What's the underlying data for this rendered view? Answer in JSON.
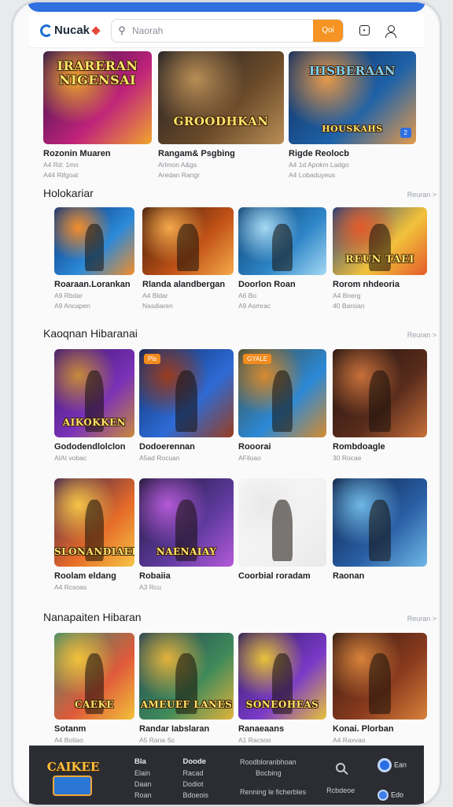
{
  "app": {
    "logo_text": "Nucak"
  },
  "search": {
    "placeholder": "Naorah",
    "button_label": "Qoi"
  },
  "header_icons": {
    "box_icon": "square-icon",
    "user_icon": "user-icon"
  },
  "featured": [
    {
      "art_title": "IRARERAN NIGENSAI",
      "title": "Rozonin Muaren",
      "sub1": "A4 Rd: 1mo",
      "sub2": "A44 Rifgoat",
      "colors": [
        "#2a1249",
        "#c0237a",
        "#f0a52d"
      ]
    },
    {
      "art_title": "GROODHKAN",
      "title": "Rangam& Psgbing",
      "sub1": "Arlmon A&gs",
      "sub2": "Aredan Rangr",
      "colors": [
        "#1c1c22",
        "#6a4a2a",
        "#b98d55"
      ]
    },
    {
      "art_title": "HISBERAAN",
      "art_sub": "HOUSKAHS",
      "badge": "2",
      "title": "Rigde Reolocb",
      "sub1": "A4 1d Apokm Ladgo",
      "sub2": "A4 Lobaduyeus",
      "colors": [
        "#0f2b5a",
        "#1f62a8",
        "#e69a4b"
      ]
    }
  ],
  "section1": {
    "title": "Holokariar",
    "see_more": "Reuran >",
    "items": [
      {
        "title": "Roaraan.Lorankan",
        "sub1": "A9 Rbdar",
        "sub2": "A9 Ancapen",
        "colors": [
          "#0b2f74",
          "#2c8ad8",
          "#f38d2a"
        ]
      },
      {
        "title": "Rlanda alandbergan",
        "sub1": "A4 Bldar",
        "sub2": "Nasdiaren",
        "colors": [
          "#3a160a",
          "#c25318",
          "#f4a94a"
        ]
      },
      {
        "title": "Doorlon Roan",
        "sub1": "A6 Bo",
        "sub2": "A9 Asmrac",
        "colors": [
          "#0a3e6e",
          "#2f86c8",
          "#a5d9f4"
        ]
      },
      {
        "art_title": "REUN TAEI",
        "title": "Rorom nhdeoria",
        "sub1": "A4 Bnerg",
        "sub2": "40 Barsian",
        "colors": [
          "#1a3c80",
          "#f2c23b",
          "#e45b2a"
        ]
      }
    ]
  },
  "section2": {
    "title": "Kaoqnan Hibaranai",
    "see_more": "Reuran >",
    "row1": [
      {
        "art_title": "AIKOKKEN",
        "title": "Gododendlolclon",
        "sub1": "AIAI vobac",
        "colors": [
          "#3b1670",
          "#7b32b8",
          "#c88a3a"
        ]
      },
      {
        "title": "Dodoerennan",
        "sub1": "A5ad Rocuan",
        "badge": "Pls",
        "colors": [
          "#0c2a62",
          "#2e6bd6",
          "#9a3c1e"
        ]
      },
      {
        "badge": "GYALE",
        "title": "Rooorai",
        "sub1": "AFiloao",
        "colors": [
          "#3e4a3a",
          "#2c89d6",
          "#d68a2e"
        ]
      },
      {
        "title": "Rombdoagle",
        "sub1": "30 Rocae",
        "colors": [
          "#1d1311",
          "#5a2c1c",
          "#c8703a"
        ]
      }
    ],
    "row2": [
      {
        "art_title": "SLONANDIAEK",
        "title": "Roolam eldang",
        "sub1": "A4 Rcsoas",
        "colors": [
          "#3a1e52",
          "#e66b28",
          "#f6c546"
        ]
      },
      {
        "art_title": "NAENAIAY",
        "title": "Robaiia",
        "sub1": "A3 Rcu",
        "colors": [
          "#1a1630",
          "#5e3a9e",
          "#b45ad8"
        ]
      },
      {
        "title": "Coorbial roradam",
        "sub1": "",
        "colors": [
          "#f7f7f7",
          "#f2f2f2",
          "#e9e9e9"
        ]
      },
      {
        "title": "Raonan",
        "sub1": "",
        "colors": [
          "#0b1e40",
          "#2a5fa6",
          "#6fb8e6"
        ]
      }
    ]
  },
  "section3": {
    "title": "Nanapaiten Hibaran",
    "see_more": "Reuran >",
    "items": [
      {
        "art_title": "CAEKE",
        "title": "Sotanm",
        "sub1": "A4 Botiao",
        "colors": [
          "#3a8a6a",
          "#e05a3a",
          "#f2c23a"
        ]
      },
      {
        "art_title": "AMEUEF LANES",
        "title": "Randar Iabslaran",
        "sub1": "A5 Rana Sc",
        "colors": [
          "#1d3e56",
          "#3f8a5a",
          "#e3b33c"
        ]
      },
      {
        "art_title": "SONEOHEAS",
        "title": "Ranaeaans",
        "sub1": "A1 Racsoo",
        "colors": [
          "#2a1a5a",
          "#7a3ac8",
          "#e8c23a"
        ]
      },
      {
        "title": "Konai. Plorban",
        "sub1": "A4 Raxvao",
        "colors": [
          "#2c1a14",
          "#8a3a1e",
          "#d8823a"
        ]
      }
    ]
  },
  "bottom_nav": {
    "logo_text": "CAIKEE",
    "col1": {
      "head": "Bla",
      "items": [
        "Elain",
        "Daan",
        "Roan"
      ]
    },
    "col2": {
      "head": "Doode",
      "items": [
        "Racad",
        "Dodiot",
        "Bdoeois"
      ]
    },
    "col3": {
      "head": "Roodbloranbhoan",
      "items": [
        "Bocbing",
        "Renning le ficherbles"
      ]
    },
    "col4": {
      "head": "",
      "items": [
        "Rcbdeoe"
      ]
    },
    "right_top": "Ean",
    "right_bottom": "Edo"
  }
}
